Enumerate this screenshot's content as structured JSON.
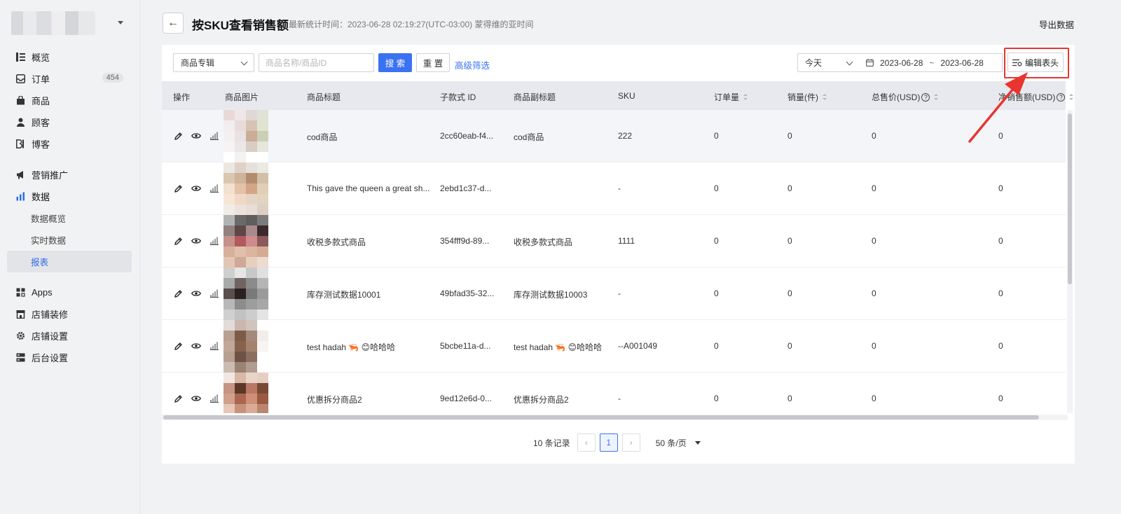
{
  "sidebar": {
    "items": [
      {
        "label": "概览",
        "icon": "overview-icon"
      },
      {
        "label": "订单",
        "icon": "order-icon",
        "badge": "454"
      },
      {
        "label": "商品",
        "icon": "product-icon"
      },
      {
        "label": "顾客",
        "icon": "customer-icon"
      },
      {
        "label": "博客",
        "icon": "blog-icon"
      },
      {
        "label": "营销推广",
        "icon": "marketing-icon"
      },
      {
        "label": "数据",
        "icon": "data-icon"
      }
    ],
    "data_subitems": [
      "数据概览",
      "实时数据",
      "报表"
    ],
    "bottom_items": [
      {
        "label": "Apps",
        "icon": "apps-icon"
      },
      {
        "label": "店铺装修",
        "icon": "store-icon"
      },
      {
        "label": "店铺设置",
        "icon": "settings-icon"
      },
      {
        "label": "后台设置",
        "icon": "admin-icon"
      }
    ]
  },
  "header": {
    "title": "按SKU查看销售额",
    "stat_time": "最新统计时间：2023-06-28 02:19:27(UTC-03:00) 蒙得维的亚时间",
    "export_label": "导出数据"
  },
  "toolbar": {
    "collection_select": "商品专辑",
    "search_placeholder": "商品名称/商品ID",
    "search_label": "搜 索",
    "reset_label": "重 置",
    "advanced_label": "高级筛选",
    "period_select": "今天",
    "date_start": "2023-06-28",
    "date_sep": "~",
    "date_end": "2023-06-28",
    "edit_header_label": "编辑表头"
  },
  "table": {
    "headers": {
      "actions": "操作",
      "image": "商品图片",
      "title": "商品标题",
      "variant_id": "子款式 ID",
      "subtitle": "商品副标题",
      "sku": "SKU",
      "orders": "订单量",
      "quantity": "销量(件)",
      "gross": "总售价(USD)",
      "net": "净销售额(USD)"
    },
    "rows": [
      {
        "title": "cod商品",
        "variant_id": "2cc60eab-f4...",
        "subtitle": "cod商品",
        "sku": "222",
        "orders": "0",
        "quantity": "0",
        "gross": "0",
        "net": "0"
      },
      {
        "title": "This gave the queen a great sh...",
        "variant_id": "2ebd1c37-d...",
        "subtitle": "",
        "sku": "-",
        "orders": "0",
        "quantity": "0",
        "gross": "0",
        "net": "0"
      },
      {
        "title": "收税多款式商品",
        "variant_id": "354fff9d-89...",
        "subtitle": "收税多款式商品",
        "sku": "1111",
        "orders": "0",
        "quantity": "0",
        "gross": "0",
        "net": "0"
      },
      {
        "title": "库存测试数据10001",
        "variant_id": "49bfad35-32...",
        "subtitle": "库存测试数据10003",
        "sku": "-",
        "orders": "0",
        "quantity": "0",
        "gross": "0",
        "net": "0"
      },
      {
        "title": "test hadah 🦐 😊哈哈哈",
        "variant_id": "5bcbe11a-d...",
        "subtitle": "test hadah 🦐 😊哈哈哈",
        "sku": "--A001049",
        "orders": "0",
        "quantity": "0",
        "gross": "0",
        "net": "0"
      },
      {
        "title": "优惠拆分商品2",
        "variant_id": "9ed12e6d-0...",
        "subtitle": "优惠拆分商品2",
        "sku": "-",
        "orders": "0",
        "quantity": "0",
        "gross": "0",
        "net": "0"
      }
    ]
  },
  "pagination": {
    "total": "10 条记录",
    "current_page": "1",
    "page_size": "50 条/页"
  },
  "colors": {
    "accent": "#3b72f1",
    "highlight": "#e8352f"
  }
}
